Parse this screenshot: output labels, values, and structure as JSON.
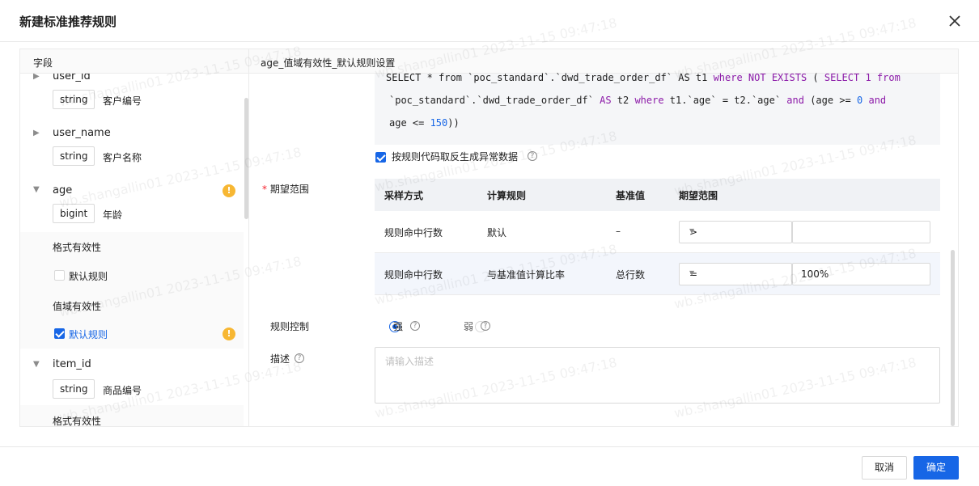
{
  "modal": {
    "title": "新建标准推荐规则"
  },
  "left_panel": {
    "header": "字段",
    "fields": [
      {
        "name": "user_id",
        "type": "string",
        "desc": "客户编号"
      },
      {
        "name": "user_name",
        "type": "string",
        "desc": "客户名称"
      },
      {
        "name": "age",
        "type": "bigint",
        "desc": "年龄",
        "warning": "!"
      },
      {
        "name": "item_id",
        "type": "string",
        "desc": "商品编号"
      }
    ],
    "age_sections": [
      {
        "label": "格式有效性",
        "rule": "默认规则",
        "checked": false
      },
      {
        "label": "值域有效性",
        "rule": "默认规则",
        "checked": true,
        "warning": "!"
      }
    ],
    "item_section": "格式有效性"
  },
  "right_panel": {
    "header": "age_值域有效性_默认规则设置",
    "code": {
      "l1_a": "SELECT * from `poc_standard`.`dwd_trade_order_df` AS t1 ",
      "l1_kw1": "where",
      "l1_kw2": " NOT EXISTS",
      "l1_b": " ( ",
      "l1_kw3": "SELECT 1 from",
      "l2_a": "`poc_standard`.`dwd_trade_order_df` ",
      "l2_kw1": "AS",
      "l2_b": " t2 ",
      "l2_kw2": "where",
      "l2_c": " t1.`age` = t2.`age` ",
      "l2_kw3": "and",
      "l2_d": " (age >= ",
      "l2_n1": "0",
      "l2_kw4": " and",
      "l3_a": "age <= ",
      "l3_n1": "150",
      "l3_b": "))"
    },
    "reverse_checkbox": "按规则代码取反生成异常数据",
    "expect_label": "期望范围",
    "required_mark": "*",
    "table": {
      "headers": [
        "采样方式",
        "计算规则",
        "基准值",
        "期望范围"
      ],
      "rows": [
        {
          "sampling": "规则命中行数",
          "calc": "默认",
          "baseline": "–",
          "op": ">",
          "value": ""
        },
        {
          "sampling": "规则命中行数",
          "calc": "与基准值计算比率",
          "baseline": "总行数",
          "op": "=",
          "value": "100%"
        }
      ]
    },
    "control_label": "规则控制",
    "control_options": [
      "强",
      "弱"
    ],
    "control_selected": "强",
    "desc_label": "描述",
    "desc_placeholder": "请输入描述",
    "help_glyph": "?"
  },
  "footer": {
    "cancel": "取消",
    "ok": "确定"
  },
  "watermark": "wb.shangallin01 2023-11-15 09:47:18",
  "colors": {
    "primary": "#1766e6",
    "warning": "#f7b733",
    "keyword": "#8c1aa8"
  }
}
